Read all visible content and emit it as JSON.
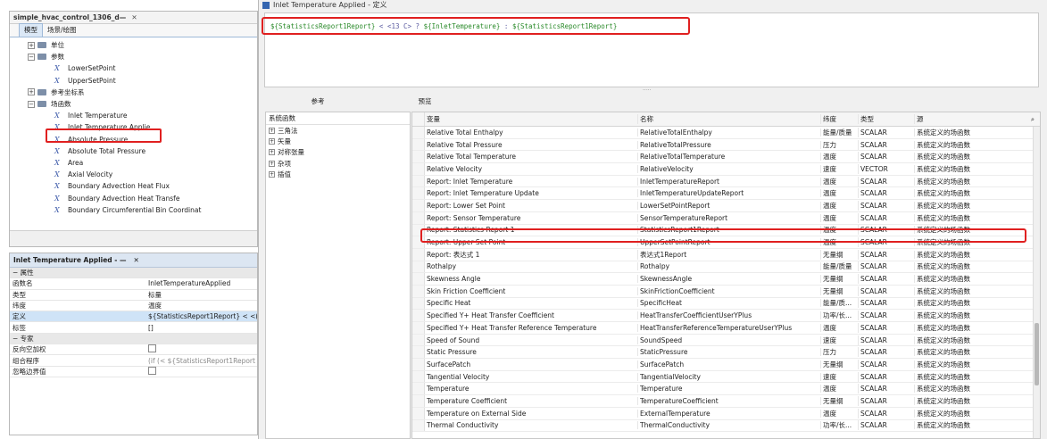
{
  "tree_panel": {
    "tab_title": "simple_hvac_control_1306_d—",
    "close": "✕",
    "subtabs": [
      "模型",
      "场景/绘图"
    ],
    "rows": [
      {
        "label": "单位",
        "type": "folder"
      },
      {
        "label": "参数",
        "type": "folder"
      },
      {
        "label": "LowerSetPoint",
        "type": "var"
      },
      {
        "label": "UpperSetPoint",
        "type": "var"
      },
      {
        "label": "参考坐标系",
        "type": "folder"
      },
      {
        "label": "场函数",
        "type": "folder"
      },
      {
        "label": "Inlet Temperature",
        "type": "var"
      },
      {
        "label": "Inlet Temperature Applie",
        "type": "var"
      },
      {
        "label": "Absolute Pressure",
        "type": "var"
      },
      {
        "label": "Absolute Total Pressure",
        "type": "var"
      },
      {
        "label": "Area",
        "type": "var"
      },
      {
        "label": "Axial Velocity",
        "type": "var"
      },
      {
        "label": "Boundary Advection Heat Flux",
        "type": "var"
      },
      {
        "label": "Boundary Advection Heat Transfe",
        "type": "var"
      },
      {
        "label": "Boundary Circumferential Bin Coordinat",
        "type": "var"
      }
    ]
  },
  "prop_panel": {
    "title": "Inlet Temperature Applied - —",
    "close": "✕",
    "rows": [
      {
        "k": "− 属性",
        "v": "",
        "kind": "section"
      },
      {
        "k": "函数名",
        "v": "InletTemperatureApplied",
        "kind": "text"
      },
      {
        "k": "类型",
        "v": "标量",
        "kind": "text"
      },
      {
        "k": "纬度",
        "v": "温度",
        "kind": "text"
      },
      {
        "k": "定义",
        "v": "${StatisticsReport1Report} < <(",
        "kind": "selected"
      },
      {
        "k": "标签",
        "v": "[]",
        "kind": "text"
      },
      {
        "k": "− 专家",
        "v": "",
        "kind": "section"
      },
      {
        "k": "反向空加权",
        "v": "",
        "kind": "check"
      },
      {
        "k": "组合程序",
        "v": "(if (< ${StatisticsReport1Report",
        "kind": "muted"
      },
      {
        "k": "忽略边界值",
        "v": "",
        "kind": "check"
      }
    ]
  },
  "dialog": {
    "title": "Inlet Temperature Applied - 定义",
    "expression_parts": [
      "${StatisticsReport1Report}",
      " < <13 C> ? ",
      "${InletTemperature}",
      " : ",
      "${StatisticsReport1Report}"
    ],
    "splitter": "·····",
    "tabs": [
      "参考",
      "预览"
    ],
    "function_header": "系统函数",
    "functions": [
      "三角法",
      "矢量",
      "对称张量",
      "杂项",
      "插值"
    ],
    "columns": [
      "变量",
      "名称",
      "纬度",
      "类型",
      "源"
    ],
    "search_icon": "⌕",
    "rows": [
      [
        "Relative Total Enthalpy",
        "RelativeTotalEnthalpy",
        "能量/质量",
        "SCALAR",
        "系统定义的场函数"
      ],
      [
        "Relative Total Pressure",
        "RelativeTotalPressure",
        "压力",
        "SCALAR",
        "系统定义的场函数"
      ],
      [
        "Relative Total Temperature",
        "RelativeTotalTemperature",
        "温度",
        "SCALAR",
        "系统定义的场函数"
      ],
      [
        "Relative Velocity",
        "RelativeVelocity",
        "速度",
        "VECTOR",
        "系统定义的场函数"
      ],
      [
        "Report: Inlet Temperature",
        "InletTemperatureReport",
        "温度",
        "SCALAR",
        "系统定义的场函数"
      ],
      [
        "Report: Inlet Temperature Update",
        "InletTemperatureUpdateReport",
        "温度",
        "SCALAR",
        "系统定义的场函数"
      ],
      [
        "Report: Lower Set Point",
        "LowerSetPointReport",
        "温度",
        "SCALAR",
        "系统定义的场函数"
      ],
      [
        "Report: Sensor Temperature",
        "SensorTemperatureReport",
        "温度",
        "SCALAR",
        "系统定义的场函数"
      ],
      [
        "Report: Statistics Report 1",
        "StatisticsReport1Report",
        "温度",
        "SCALAR",
        "系统定义的场函数"
      ],
      [
        "Report: Upper Set Point",
        "UpperSetPointReport",
        "温度",
        "SCALAR",
        "系统定义的场函数"
      ],
      [
        "Report: 表达式 1",
        "表达式1Report",
        "无量纲",
        "SCALAR",
        "系统定义的场函数"
      ],
      [
        "Rothalpy",
        "Rothalpy",
        "能量/质量",
        "SCALAR",
        "系统定义的场函数"
      ],
      [
        "Skewness Angle",
        "SkewnessAngle",
        "无量纲",
        "SCALAR",
        "系统定义的场函数"
      ],
      [
        "Skin Friction Coefficient",
        "SkinFrictionCoefficient",
        "无量纲",
        "SCALAR",
        "系统定义的场函数"
      ],
      [
        "Specific Heat",
        "SpecificHeat",
        "能量/质...",
        "SCALAR",
        "系统定义的场函数"
      ],
      [
        "Specified Y+ Heat Transfer Coefficient",
        "HeatTransferCoefficientUserYPlus",
        "功率/长...",
        "SCALAR",
        "系统定义的场函数"
      ],
      [
        "Specified Y+ Heat Transfer Reference Temperature",
        "HeatTransferReferenceTemperatureUserYPlus",
        "温度",
        "SCALAR",
        "系统定义的场函数"
      ],
      [
        "Speed of Sound",
        "SoundSpeed",
        "速度",
        "SCALAR",
        "系统定义的场函数"
      ],
      [
        "Static Pressure",
        "StaticPressure",
        "压力",
        "SCALAR",
        "系统定义的场函数"
      ],
      [
        "SurfacePatch",
        "SurfacePatch",
        "无量纲",
        "SCALAR",
        "系统定义的场函数"
      ],
      [
        "Tangential Velocity",
        "TangentialVelocity",
        "速度",
        "SCALAR",
        "系统定义的场函数"
      ],
      [
        "Temperature",
        "Temperature",
        "温度",
        "SCALAR",
        "系统定义的场函数"
      ],
      [
        "Temperature Coefficient",
        "TemperatureCoefficient",
        "无量纲",
        "SCALAR",
        "系统定义的场函数"
      ],
      [
        "Temperature on External Side",
        "ExternalTemperature",
        "温度",
        "SCALAR",
        "系统定义的场函数"
      ],
      [
        "Thermal Conductivity",
        "ThermalConductivity",
        "功率/长...",
        "SCALAR",
        "系统定义的场函数"
      ]
    ]
  },
  "colors": {
    "highlight": "#e02020",
    "selection": "#cfe3f7",
    "expr_green": "#2a8a2a"
  }
}
